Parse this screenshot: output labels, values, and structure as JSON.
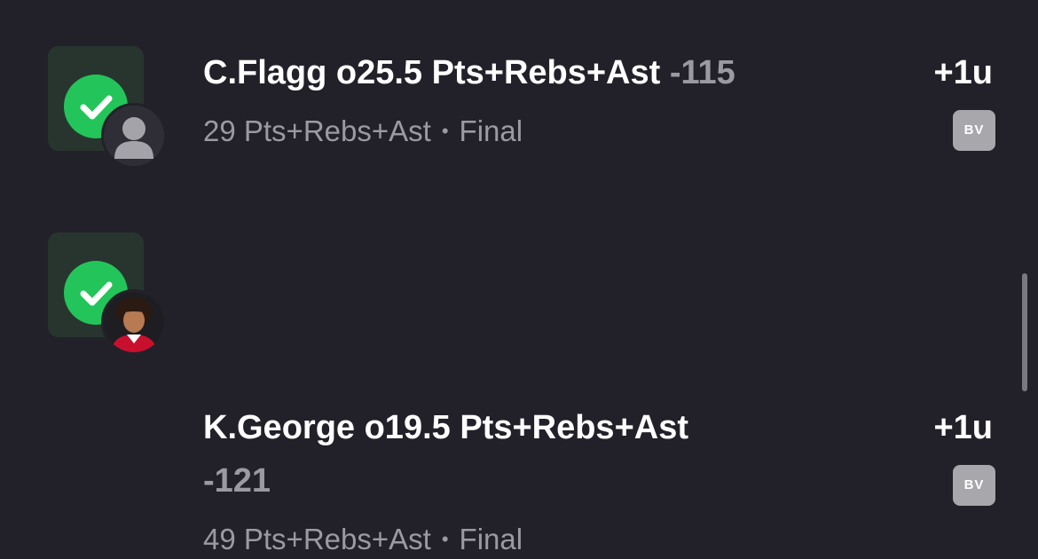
{
  "colors": {
    "background": "#22212a",
    "success_green": "#23c55a",
    "tile": "#28352f",
    "muted_text": "#9b9aa1",
    "badge": "#a7a7ac"
  },
  "bets": [
    {
      "player_pick": "C.Flagg o25.5 Pts+Rebs+Ast",
      "odds": "-115",
      "result_stat": "29 Pts+Rebs+Ast",
      "status": "Final",
      "units": "+1u",
      "badge": "BV",
      "status_icon": "check-circle-icon",
      "avatar": "default-avatar-icon"
    },
    {
      "player_pick": "K.George o19.5 Pts+Rebs+Ast",
      "odds": "-121",
      "result_stat": "49 Pts+Rebs+Ast",
      "status": "Final",
      "units": "+1u",
      "badge": "BV",
      "status_icon": "check-circle-icon",
      "avatar": "player-photo-avatar"
    }
  ],
  "separator": "•"
}
